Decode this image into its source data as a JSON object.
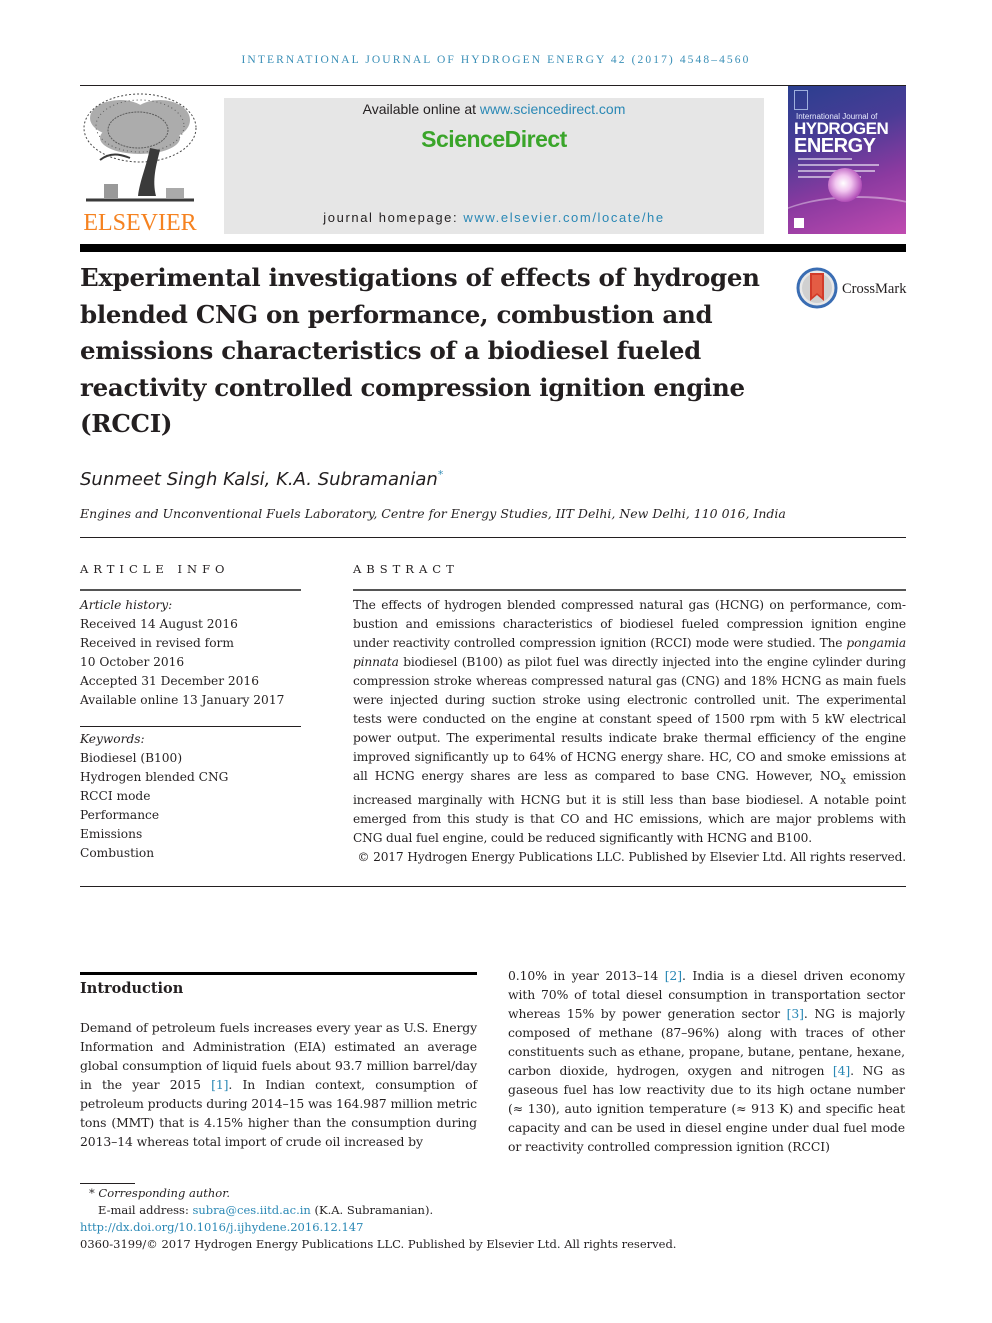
{
  "running_head": "INTERNATIONAL JOURNAL OF HYDROGEN ENERGY 42 (2017) 4548–4560",
  "publisher": {
    "logo_word": "ELSEVIER",
    "available_online_prefix": "Available online at ",
    "available_online_link": "www.sciencedirect.com",
    "brand": "ScienceDirect",
    "homepage_prefix": "journal homepage: ",
    "homepage_link": "www.elsevier.com/locate/he"
  },
  "cover": {
    "line1": "International Journal of",
    "line2": "HYDROGEN",
    "line3": "ENERGY"
  },
  "crossmark": {
    "label": "CrossMark"
  },
  "article": {
    "title": "Experimental investigations of effects of hydrogen blended CNG on performance, combustion and emissions characteristics of a biodiesel fueled reactivity controlled compression ignition engine (RCCI)",
    "authors": "Sunmeet Singh  Kalsi, K.A. Subramanian",
    "author_mark": "*",
    "affiliation": "Engines and Unconventional Fuels Laboratory, Centre for Energy Studies, IIT Delhi, New Delhi, 110 016, India"
  },
  "article_info": {
    "heading": "ARTICLE INFO",
    "history_label": "Article history:",
    "history": [
      "Received 14 August 2016",
      "Received in revised form",
      "10 October 2016",
      "Accepted 31 December 2016",
      "Available online 13 January 2017"
    ],
    "keywords_label": "Keywords:",
    "keywords": [
      "Biodiesel (B100)",
      "Hydrogen blended CNG",
      "RCCI mode",
      "Performance",
      "Emissions",
      "Combustion"
    ]
  },
  "abstract": {
    "heading": "ABSTRACT",
    "part1": "The effects of hydrogen blended compressed natural gas (HCNG) on performance, com­bustion and emissions characteristics of biodiesel fueled compression ignition engine under reactivity controlled compression ignition (RCCI) mode were studied. The ",
    "italic_species": "pongamia pinnata",
    "part2": " biodiesel (B100) as pilot fuel was directly injected into the engine cylinder during compression stroke whereas compressed natural gas (CNG) and 18% HCNG as main fuels were injected during suction stroke using electronic controlled unit. The experimental tests were conducted on the engine at constant speed of 1500 rpm with 5 kW electrical power output. The experimental results indicate brake thermal efficiency of the engine improved significantly up to 64% of HCNG energy share. HC, CO and smoke emissions at all HCNG energy shares are less as compared to base CNG. However, NO",
    "subscript_x": "x",
    "part3": " emission increased marginally with HCNG but it is still less than base biodiesel. A notable point emerged from this study is that CO and HC emissions, which are major problems with CNG dual fuel engine, could be reduced significantly with HCNG and B100.",
    "copyright": "© 2017 Hydrogen Energy Publications LLC. Published by Elsevier Ltd. All rights reserved."
  },
  "introduction": {
    "heading": "Introduction",
    "left": {
      "t1": "Demand of petroleum fuels increases every year as U.S. En­ergy Information and Administration (EIA) estimated an average global consumption of liquid fuels about 93.7 million barrel/day in the year 2015 ",
      "r1": "[1]",
      "t2": ". In Indian context, consumption of petroleum products during 2014–15 was 164.987 million metric tons (MMT) that is 4.15% higher than the consumption during 2013–14 whereas total import of crude oil increased by"
    },
    "right": {
      "t1": "0.10% in year 2013–14 ",
      "r2": "[2]",
      "t2": ". India is a diesel driven economy with 70% of total diesel consumption in transportation sector whereas 15% by power generation sector ",
      "r3": "[3]",
      "t3": ". NG is majorly composed of methane (87–96%) along with traces of other constituents such as ethane, propane, butane, pentane, hex­ane, carbon dioxide, hydrogen, oxygen and nitrogen ",
      "r4": "[4]",
      "t4": ". NG as gaseous fuel has low reactivity due to its high octane number (≈ 130), auto ignition temperature (≈ 913 K) and specific heat capacity and can be used in diesel engine under dual fuel mode or reactivity controlled compression ignition (RCCI)"
    }
  },
  "footnotes": {
    "corresponding": "* Corresponding author.",
    "email_label": "E-mail address: ",
    "email": "subra@ces.iitd.ac.in",
    "email_suffix": " (K.A. Subramanian).",
    "doi": "http://dx.doi.org/10.1016/j.ijhydene.2016.12.147",
    "issn_line": "0360-3199/© 2017 Hydrogen Energy Publications LLC. Published by Elsevier Ltd. All rights reserved."
  }
}
